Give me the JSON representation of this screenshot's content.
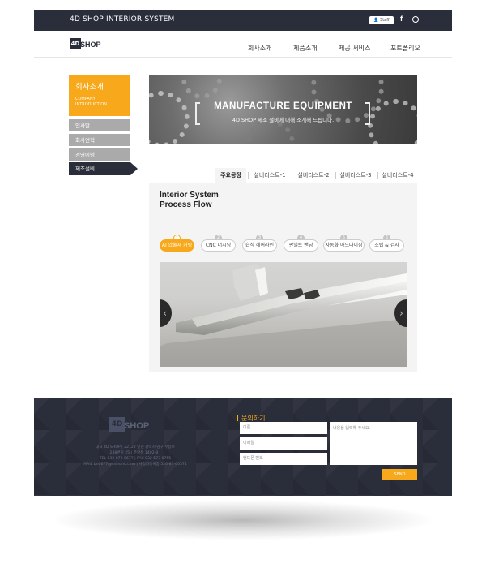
{
  "topbar": {
    "brand": "4D SHOP INTERIOR SYSTEM",
    "staff_label": "Staff Only",
    "facebook_icon": "f"
  },
  "header": {
    "logo_mark": "4D",
    "logo_text": "SHOP",
    "nav": [
      "회사소개",
      "제품소개",
      "제공 서비스",
      "포트폴리오"
    ]
  },
  "sidebar": {
    "title_ko": "회사소개",
    "title_en": "COMPANY INTRODUCTION",
    "items": [
      "인사말",
      "회사연혁",
      "경영이념"
    ],
    "active": "제조설비"
  },
  "banner": {
    "title": "MANUFACTURE EQUIPMENT",
    "subtitle": "4D SHOP 제조 설비에 대해 소개해 드립니다."
  },
  "tabs": [
    "주요공정",
    "설비리스트-1",
    "설비리스트-2",
    "설비리스트-3",
    "설비리스트-4"
  ],
  "content": {
    "title_line1": "Interior System",
    "title_line2": "Process Flow",
    "steps": [
      {
        "num": "1",
        "label": "AI 압출재 커팅"
      },
      {
        "num": "2",
        "label": "CNC 머시닝"
      },
      {
        "num": "3",
        "label": "습식 헤어라인"
      },
      {
        "num": "4",
        "label": "판넬트 밴딩"
      },
      {
        "num": "5",
        "label": "자동화 아노다이징"
      },
      {
        "num": "6",
        "label": "조립 & 검사"
      }
    ],
    "prev_icon": "‹",
    "next_icon": "›"
  },
  "footer": {
    "logo_mark": "4D",
    "logo_text": "SHOP",
    "info_lines": [
      "대표 4D SHOP | 22122 인천 광역시 남구 주승로",
      "238번길 25 ( 주안동 1402-8 )",
      "TEL 032 872 0677 | FAX 032 573 0755",
      "MAIL bn0677@4dhsinc.com | 사업자등록증 520-81-00371"
    ],
    "contact_title": "문의하기",
    "name_placeholder": "이름",
    "email_placeholder": "이메일",
    "phone_placeholder": "핸드폰 번호",
    "message_placeholder": "내용을 입력해 주세요.",
    "send_label": "SEND"
  },
  "colors": {
    "dark": "#2a2d3a",
    "accent": "#f7a81b",
    "sidebar_gray": "#aaaaaa"
  }
}
